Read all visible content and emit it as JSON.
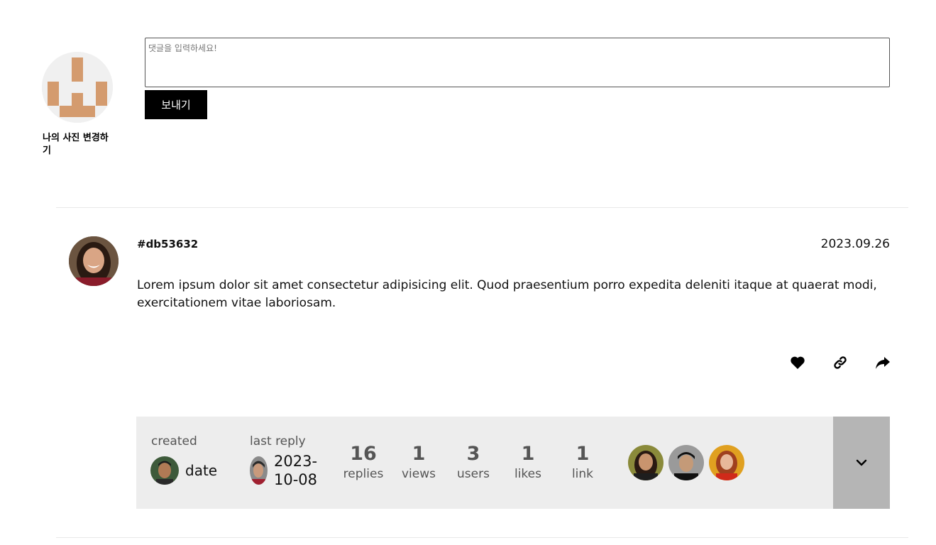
{
  "composer": {
    "placeholder": "댓글을 입력하세요!",
    "send_label": "보내기",
    "change_photo_label": "나의 사진 변경하기"
  },
  "comment": {
    "author_id": "#db53632",
    "date": "2023.09.26",
    "body": "Lorem ipsum dolor sit amet consectetur adipisicing elit. Quod praesentium porro expedita deleniti itaque at quaerat modi, exercitationem vitae laboriosam.",
    "actions": [
      {
        "name": "heart-icon"
      },
      {
        "name": "link-icon"
      },
      {
        "name": "share-icon"
      }
    ]
  },
  "stats": {
    "created_label": "created",
    "created_value": "date",
    "last_reply_label": "last reply",
    "last_reply_value": "2023-10-08",
    "replies_count": "16",
    "replies_label": "replies",
    "views_count": "1",
    "views_label": "views",
    "users_count": "3",
    "users_label": "users",
    "likes_count": "1",
    "likes_label": "likes",
    "link_count": "1",
    "link_label": "link"
  },
  "colors": {
    "send_button_bg": "#000000",
    "stats_bg": "#ededed",
    "expand_bg": "#b5b5b5",
    "identicon": "#d49b6e"
  }
}
